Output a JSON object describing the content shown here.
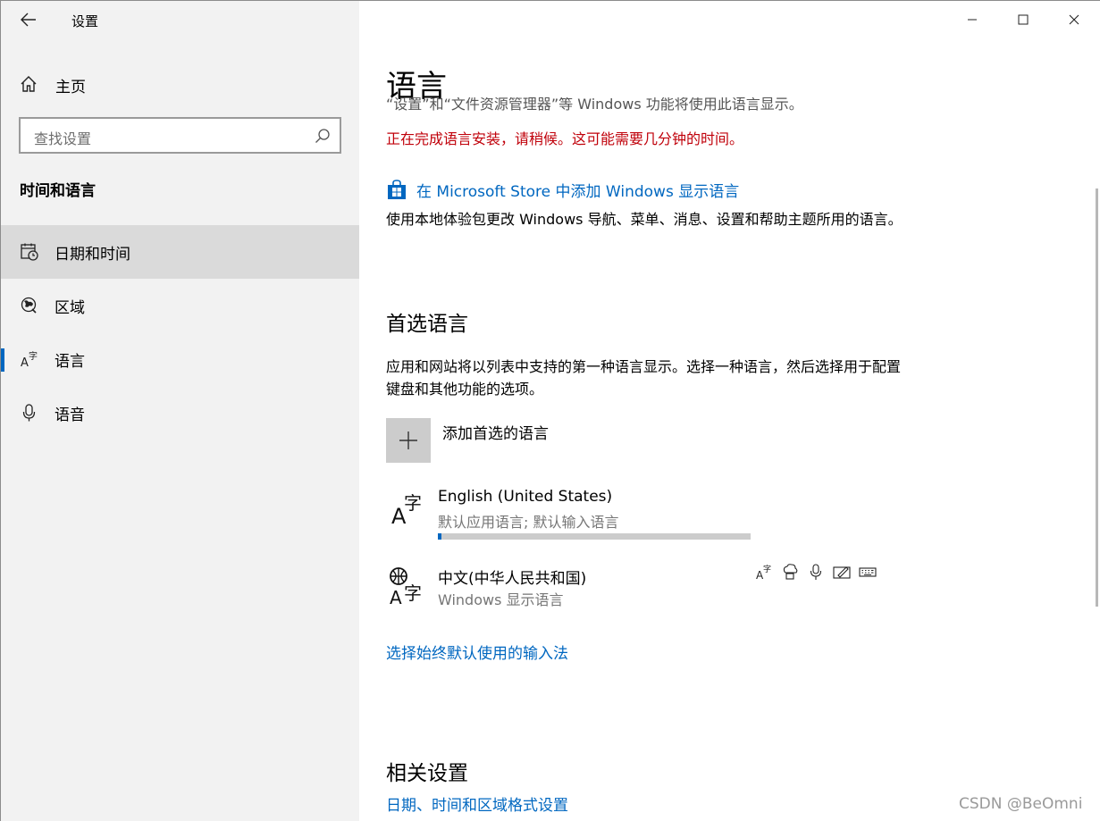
{
  "window": {
    "title": "设置",
    "controls": {
      "minimize": "minimize-icon",
      "maximize": "maximize-icon",
      "close": "close-icon"
    }
  },
  "sidebar": {
    "home": {
      "label": "主页",
      "icon": "home-icon"
    },
    "search": {
      "placeholder": "查找设置",
      "icon": "search-icon"
    },
    "group_title": "时间和语言",
    "items": [
      {
        "label": "日期和时间",
        "icon": "date-time-icon",
        "state": "hover"
      },
      {
        "label": "区域",
        "icon": "region-icon",
        "state": "normal"
      },
      {
        "label": "语言",
        "icon": "language-icon",
        "state": "selected"
      },
      {
        "label": "语音",
        "icon": "microphone-icon",
        "state": "normal"
      }
    ]
  },
  "main": {
    "title": "语言",
    "clipped_text": "“设置”和“文件资源管理器”等 Windows 功能将使用此语言显示。",
    "warning": "正在完成语言安装，请稍候。这可能需要几分钟的时间。",
    "store_link": "在 Microsoft Store 中添加 Windows 显示语言",
    "store_desc": "使用本地体验包更改 Windows 导航、菜单、消息、设置和帮助主题所用的语言。",
    "preferred": {
      "title": "首选语言",
      "desc": "应用和网站将以列表中支持的第一种语言显示。选择一种语言，然后选择用于配置键盘和其他功能的选项。",
      "add_label": "添加首选的语言",
      "languages": [
        {
          "name": "English (United States)",
          "sub": "默认应用语言; 默认输入语言",
          "progress": 0.01
        },
        {
          "name": "中文(中华人民共和国)",
          "sub": "Windows 显示语言"
        }
      ],
      "feature_icons": [
        "language-pack-icon",
        "text-to-speech-icon",
        "speech-recognition-icon",
        "handwriting-icon",
        "keyboard-icon"
      ],
      "input_method_link": "选择始终默认使用的输入法"
    },
    "related": {
      "title": "相关设置",
      "link": "日期、时间和区域格式设置"
    }
  },
  "watermark": "CSDN @BeOmni",
  "colors": {
    "accent": "#0067c0",
    "warning": "#c0000a",
    "sidebar_bg": "#f2f2f2",
    "selected_bg": "#dadada"
  }
}
